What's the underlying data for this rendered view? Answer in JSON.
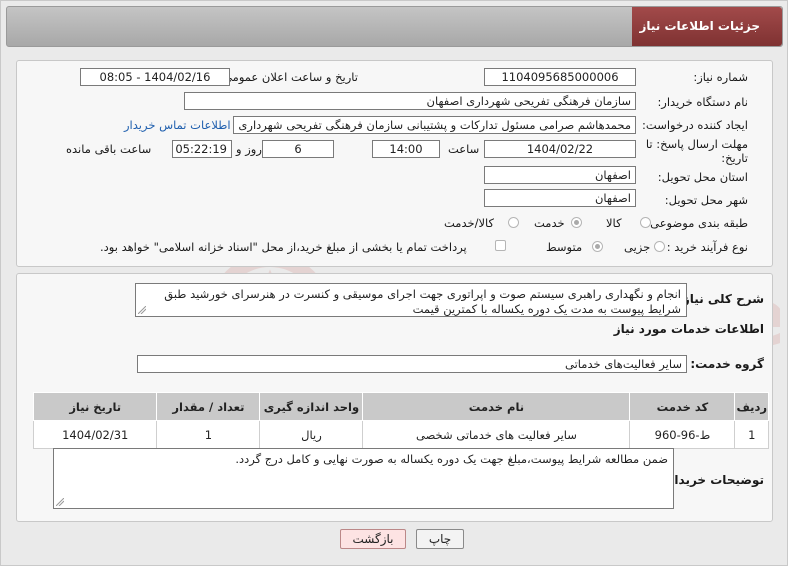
{
  "header": {
    "title": "جزئیات اطلاعات نیاز"
  },
  "form": {
    "need_number": {
      "label": "شماره نیاز:",
      "value": "1104095685000006"
    },
    "announce_datetime": {
      "label": "تاریخ و ساعت اعلان عمومی:",
      "value": "1404/02/16 - 08:05"
    },
    "buyer_org": {
      "label": "نام دستگاه خریدار:",
      "value": "سازمان فرهنگی تفریحی شهرداری اصفهان"
    },
    "requester": {
      "label": "ایجاد کننده درخواست:",
      "value": "محمدهاشم صرامی مسئول تدارکات و پشتیبانی سازمان فرهنگی تفریحی شهرداری",
      "contact_link": "اطلاعات تماس خریدار"
    },
    "deadline": {
      "label": "مهلت ارسال پاسخ: تا تاریخ:",
      "date": "1404/02/22",
      "time_label": "ساعت",
      "time": "14:00",
      "days": "6",
      "days_label": "روز و",
      "remaining": "05:22:19",
      "remaining_label": "ساعت باقی مانده"
    },
    "delivery_province": {
      "label": "استان محل تحویل:",
      "value": "اصفهان"
    },
    "delivery_city": {
      "label": "شهر محل تحویل:",
      "value": "اصفهان"
    },
    "category": {
      "label": "طبقه بندی موضوعی:",
      "options": [
        "کالا",
        "خدمت",
        "کالا/خدمت"
      ],
      "selected": "خدمت"
    },
    "purchase_type": {
      "label": "نوع فرآیند خرید :",
      "options": [
        "جزیی",
        "متوسط"
      ],
      "selected": "متوسط",
      "note": "پرداخت تمام یا بخشی از مبلغ خرید،از محل \"اسناد خزانه اسلامی\" خواهد بود."
    }
  },
  "summary": {
    "label": "شرح کلی نیاز:",
    "text": "انجام و نگهداری راهبری سیستم صوت و اپراتوری جهت اجرای موسیقی و کنسرت در هنرسرای خورشید طبق شرایط پیوست به مدت یک دوره یکساله با کمترین قیمت"
  },
  "services": {
    "heading": "اطلاعات خدمات مورد نیاز",
    "group_label": "گروه خدمت:",
    "group_value": "سایر فعالیت‌های خدماتی",
    "columns": [
      "ردیف",
      "کد خدمت",
      "نام خدمت",
      "واحد اندازه گیری",
      "تعداد / مقدار",
      "تاریخ نیاز"
    ],
    "rows": [
      [
        "1",
        "ط-96-960",
        "سایر فعالیت های خدماتی شخصی",
        "ریال",
        "1",
        "1404/02/31"
      ]
    ]
  },
  "buyer_notes": {
    "label": "توضیحات خریدار:",
    "text": "ضمن مطالعه شرایط پیوست،مبلغ جهت یک دوره یکساله به صورت نهایی و کامل درج گردد."
  },
  "buttons": {
    "print": "چاپ",
    "back": "بازگشت"
  },
  "colors": {
    "title_bg": "#8a3838",
    "link": "#1f5fae",
    "back_button": "#fde3e3",
    "watermark": "#c0392b"
  }
}
